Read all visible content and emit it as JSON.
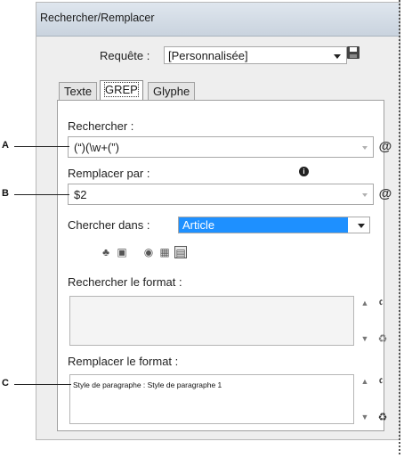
{
  "window": {
    "title": "Rechercher/Remplacer"
  },
  "query": {
    "label": "Requête :",
    "value": "[Personnalisée]"
  },
  "tabs": [
    {
      "label": "Texte"
    },
    {
      "label": "GREP"
    },
    {
      "label": "Glyphe"
    }
  ],
  "search": {
    "label": "Rechercher :",
    "value": "(“)(\\w+(”)"
  },
  "replace": {
    "label": "Remplacer par :",
    "value": "$2"
  },
  "search_in": {
    "label": "Chercher dans :",
    "value": "Article"
  },
  "find_format": {
    "label": "Rechercher le format :",
    "value": ""
  },
  "change_format": {
    "label": "Remplacer le format :",
    "value": "Style de paragraphe : Style de paragraphe 1"
  },
  "callouts": [
    "A",
    "B",
    "C"
  ],
  "icons": {
    "info": "i",
    "at": "@",
    "scope": [
      "locked-layers-icon",
      "locked-stories-icon",
      "hidden-layers-icon",
      "master-pages-icon",
      "footnotes-icon"
    ],
    "format_side": [
      "format-search-icon",
      "clear-format-icon"
    ]
  },
  "colors": {
    "accent": "#1e90ff",
    "titlebar": "#c9d3de"
  }
}
